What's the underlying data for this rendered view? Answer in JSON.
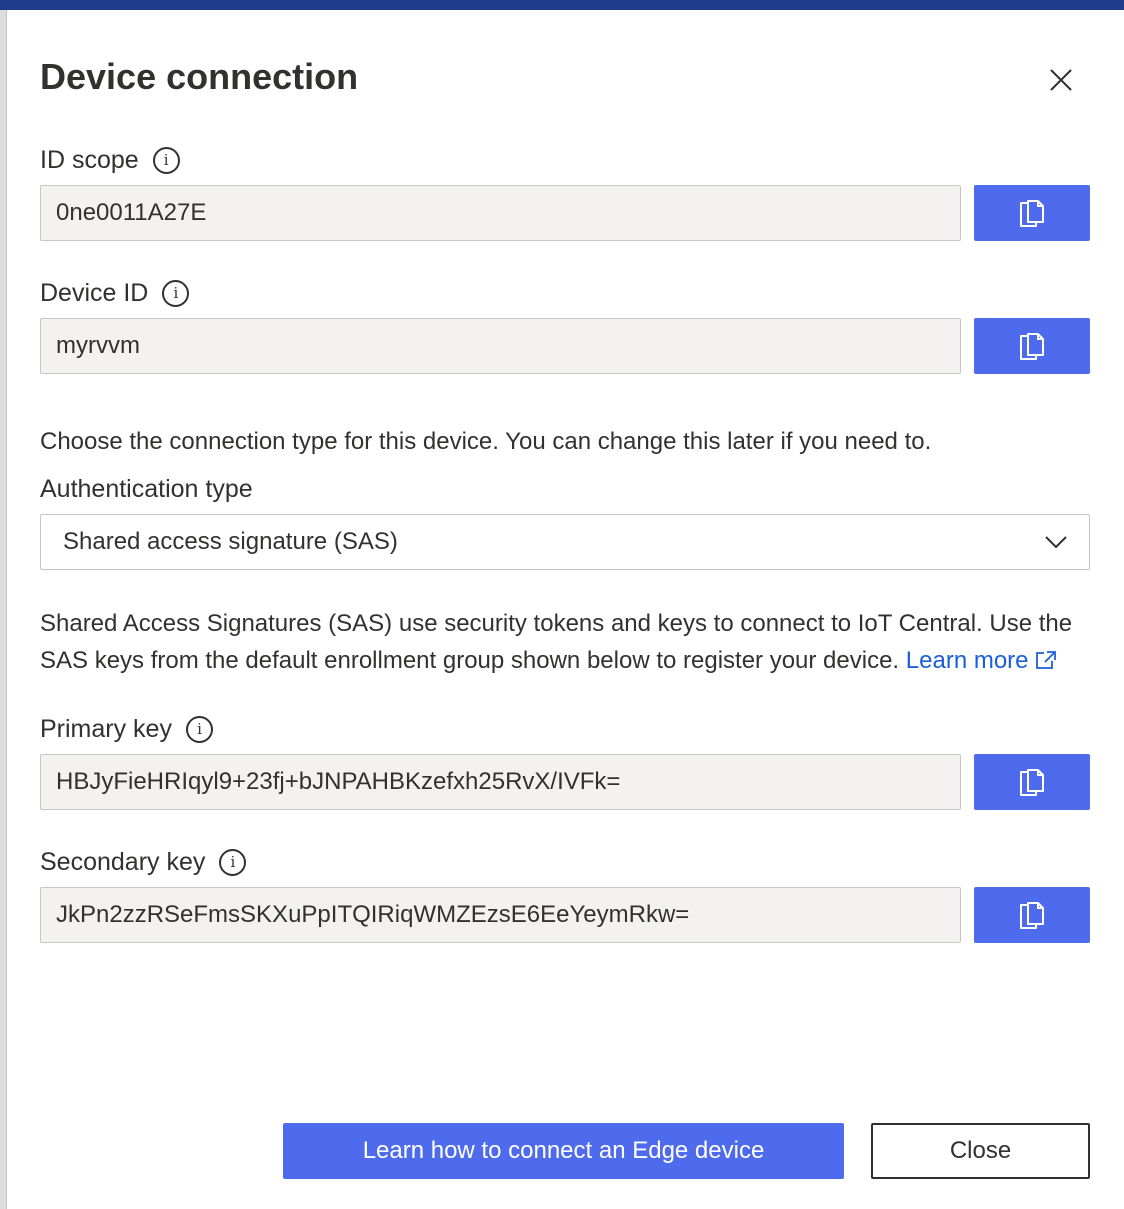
{
  "dialog": {
    "title": "Device connection",
    "close_icon": "close-icon"
  },
  "id_scope": {
    "label": "ID scope",
    "value": "0ne0011A27E",
    "info_icon": "info-icon",
    "copy_icon": "copy-icon"
  },
  "device_id": {
    "label": "Device ID",
    "value": "myrvvm",
    "info_icon": "info-icon",
    "copy_icon": "copy-icon"
  },
  "connection_text": "Choose the connection type for this device. You can change this later if you need to.",
  "auth": {
    "label": "Authentication type",
    "selected": "Shared access signature (SAS)",
    "chevron_icon": "chevron-down-icon"
  },
  "sas_description": {
    "line1": "Shared Access Signatures (SAS) use security tokens and keys to connect to IoT Central. Use the",
    "line2": "SAS keys from the default enrollment group shown below to register your device.",
    "link": "Learn more",
    "link_icon": "external-link-icon"
  },
  "primary_key": {
    "label": "Primary key",
    "value": "HBJyFieHRIqyl9+23fj+bJNPAHBKzefxh25RvX/IVFk=",
    "info_icon": "info-icon",
    "copy_icon": "copy-icon"
  },
  "secondary_key": {
    "label": "Secondary key",
    "value": "JkPn2zzRSeFmsSKXuPpITQIRiqWMZEzsE6EeYeymRkw=",
    "info_icon": "info-icon",
    "copy_icon": "copy-icon"
  },
  "footer": {
    "primary_button": "Learn how to connect an Edge device",
    "close_button": "Close"
  },
  "colors": {
    "accent": "#4f6bed",
    "link": "#1a5fd9",
    "field_bg": "#f3f2f1",
    "text": "#323130"
  }
}
